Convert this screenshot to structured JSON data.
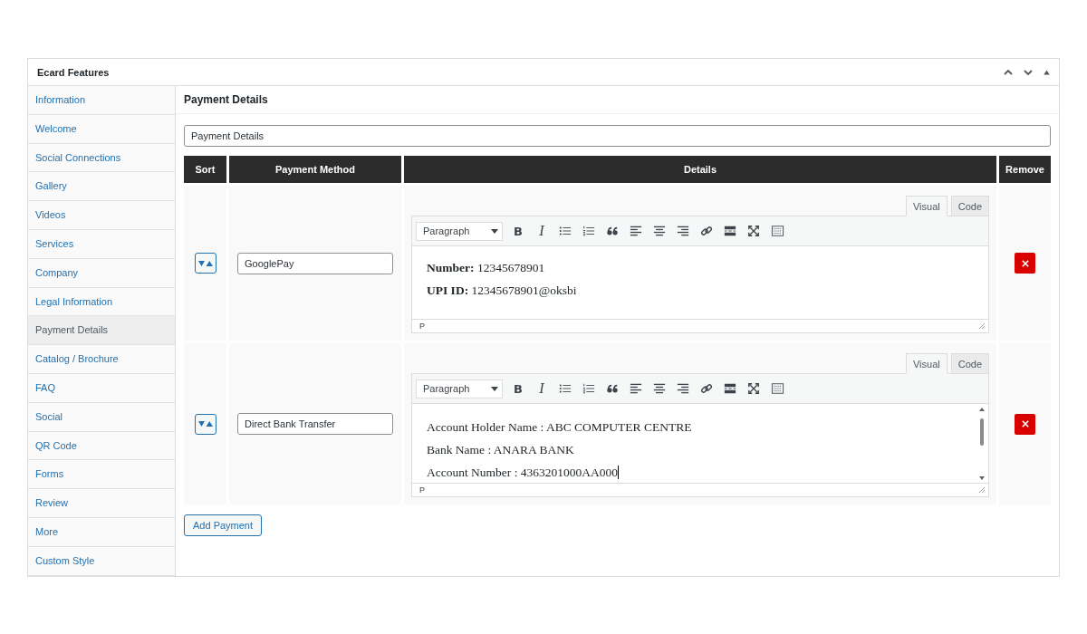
{
  "panel": {
    "title": "Ecard Features"
  },
  "sidebar": {
    "items": [
      {
        "label": "Information",
        "selected": false
      },
      {
        "label": "Welcome",
        "selected": false
      },
      {
        "label": "Social Connections",
        "selected": false
      },
      {
        "label": "Gallery",
        "selected": false
      },
      {
        "label": "Videos",
        "selected": false
      },
      {
        "label": "Services",
        "selected": false
      },
      {
        "label": "Company",
        "selected": false
      },
      {
        "label": "Legal Information",
        "selected": false
      },
      {
        "label": "Payment Details",
        "selected": true
      },
      {
        "label": "Catalog / Brochure",
        "selected": false
      },
      {
        "label": "FAQ",
        "selected": false
      },
      {
        "label": "Social",
        "selected": false
      },
      {
        "label": "QR Code",
        "selected": false
      },
      {
        "label": "Forms",
        "selected": false
      },
      {
        "label": "Review",
        "selected": false
      },
      {
        "label": "More",
        "selected": false
      },
      {
        "label": "Custom Style",
        "selected": false
      }
    ]
  },
  "section": {
    "title": "Payment Details",
    "name_field": {
      "value": "Payment Details"
    }
  },
  "table": {
    "columns": [
      "Sort",
      "Payment Method",
      "Details",
      "Remove"
    ],
    "rows": [
      {
        "method": "GooglePay",
        "editor": {
          "tabs": [
            {
              "label": "Visual",
              "selected": true
            },
            {
              "label": "Code",
              "selected": false
            }
          ],
          "format": "Paragraph",
          "bold_key": "B",
          "italic_key": "I",
          "lines": [
            "**Number:** 12345678901",
            "**UPI ID:** 12345678901@oksbi"
          ],
          "path": "P",
          "scrollable": false,
          "focused": false
        }
      },
      {
        "method": "Direct Bank Transfer",
        "editor": {
          "tabs": [
            {
              "label": "Visual",
              "selected": true
            },
            {
              "label": "Code",
              "selected": false
            }
          ],
          "format": "Paragraph",
          "bold_key": "B",
          "italic_key": "I",
          "lines": [
            "Account Holder Name : ABC COMPUTER CENTRE",
            "Bank Name : ANARA BANK",
            "Account Number : 4363201000AA000"
          ],
          "path": "P",
          "scrollable": true,
          "focused": true
        }
      }
    ]
  },
  "add_button": {
    "label": "Add Payment"
  }
}
